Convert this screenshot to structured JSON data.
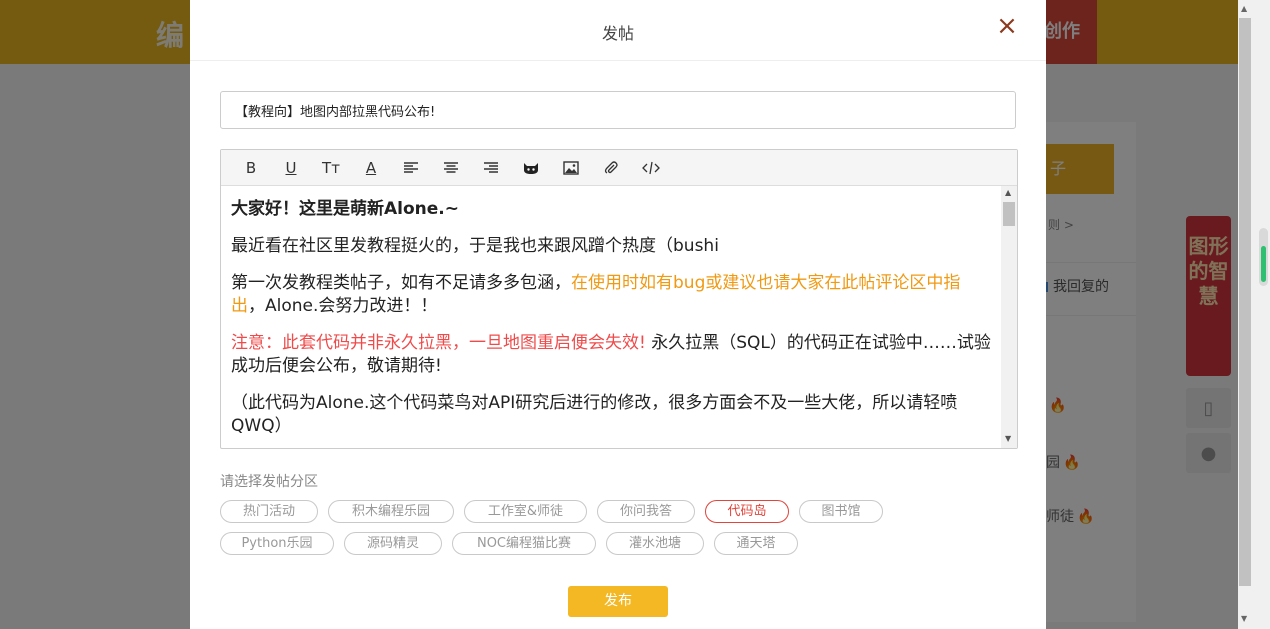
{
  "background": {
    "logo_text": "编",
    "create_label": "创作",
    "side_post_label": "子",
    "side_rule": "则 >",
    "side_reply_label": "我回复的",
    "side_items": [
      "园",
      "师徒"
    ],
    "banner_text": "图形的智慧"
  },
  "modal": {
    "title": "发帖",
    "close_icon": "×",
    "post_title_value": "【教程向】地图内部拉黑代码公布!"
  },
  "toolbar": {
    "bold": "B",
    "underline": "U",
    "font_size": "Tт",
    "font_color": "A"
  },
  "content": {
    "p1": "大家好！这里是萌新Alone.~",
    "p2": "最近看在社区里发教程挺火的，于是我也来跟风蹭个热度（bushi",
    "p3a": "第一次发教程类帖子，如有不足请多多包涵，",
    "p3b": "在使用时如有bug或建议也请大家在此帖评论区中指出",
    "p3c": "，Alone.会努力改进！！",
    "p4a": "注意：此套代码并非永久拉黑，一旦地图重启便会失效!",
    "p4b": " 永久拉黑（SQL）的代码正在试验中……试验成功后便会公布，敬请期待!",
    "p5": "（此代码为Alone.这个代码菜鸟对API研究后进行的修改，很多方面会不及一些大佬，所以请轻喷QWQ）"
  },
  "section_label": "请选择发帖分区",
  "categories": [
    "热门活动",
    "积木编程乐园",
    "工作室&师徒",
    "你问我答",
    "代码岛",
    "图书馆",
    "Python乐园",
    "源码精灵",
    "NOC编程猫比赛",
    "灌水池塘",
    "通天塔"
  ],
  "selected_category": "代码岛",
  "publish_label": "发布",
  "colors": {
    "accent": "#f3b824",
    "highlight_orange": "#f09a14",
    "warning_red": "#f04b4b",
    "selected_border": "#e0463c"
  }
}
